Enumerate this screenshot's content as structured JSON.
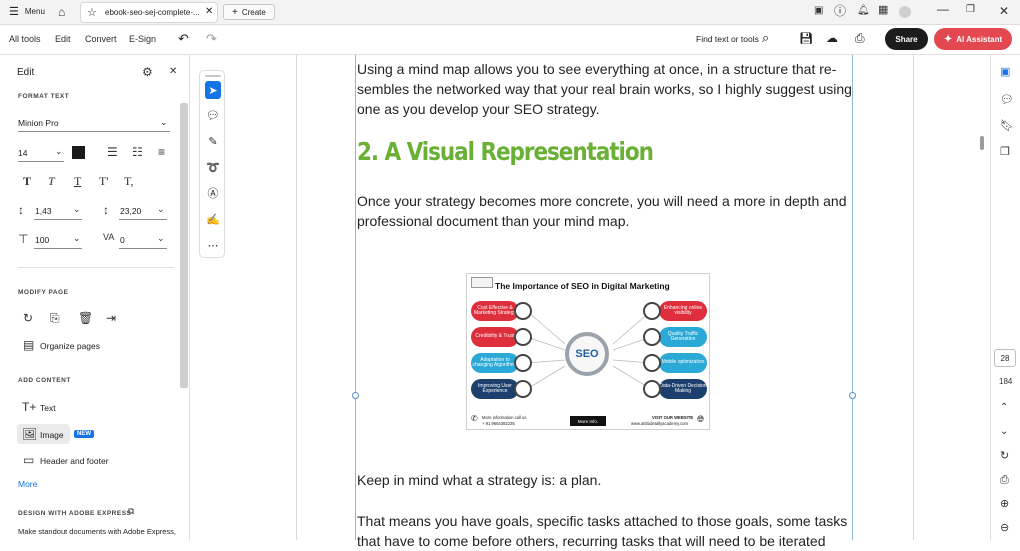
{
  "titlebar": {
    "menu_label": "Menu",
    "doc_tab": "ebook-seo-sej-complete-...",
    "create_label": "Create"
  },
  "toolbar": {
    "tabs": [
      "All tools",
      "Edit",
      "Convert",
      "E-Sign"
    ],
    "find_label": "Find text or tools",
    "share_label": "Share",
    "ai_label": "AI Assistant"
  },
  "left_panel": {
    "title": "Edit",
    "format_text_heading": "FORMAT TEXT",
    "font_name": "Minion Pro",
    "font_size": "14",
    "line_spacing": "1,43",
    "para_spacing": "23,20",
    "scale": "100",
    "char_spacing": "0",
    "modify_page_heading": "MODIFY PAGE",
    "organize_pages": "Organize pages",
    "add_content_heading": "ADD CONTENT",
    "text_item": "Text",
    "image_item": "Image",
    "new_badge": "NEW",
    "header_footer_item": "Header and footer",
    "more_link": "More",
    "design_heading": "DESIGN WITH ADOBE EXPRESS",
    "design_text": "Make standout documents with Adobe Express,"
  },
  "document": {
    "para1": "Using a mind map allows you to see everything at once, in a structure that re-sembles the networked way that your real brain works, so I highly suggest using one as you develop your SEO strategy.",
    "heading": "2. A Visual Representation",
    "para2": "Once your strategy becomes more concrete, you will need a more in depth and professional document than your mind map.",
    "para3": "Keep in mind what a strategy is: a plan.",
    "para4": "That means you have goals, specific tasks attached to those goals, some tasks that have to come before others, recurring tasks that will need to be iterated"
  },
  "infographic": {
    "title": "The  Importance of SEO in Digital Marketing",
    "center": "SEO",
    "left_items": [
      "Cost Effective & Marketing Strategy",
      "Credibility & Trust",
      "Adaptation to changing Algorithms",
      "Improving User Experience"
    ],
    "right_items": [
      "Enhancing online visibility",
      "Quality Traffic Generation",
      "Mobile optimization",
      "Data-Driven Decision Making"
    ],
    "footer_left": "More information call us",
    "footer_phone": "+ 91 9654382235",
    "footer_button": "More Info.",
    "footer_right": "VISIT OUR WEBSITE",
    "footer_url": "www.attitudetallyacademy.com",
    "colors": {
      "red": "#e02f3c",
      "cyan": "#2aa9d6",
      "navy": "#1c3f6e"
    }
  },
  "right_rail": {
    "current_page": "28",
    "total_pages": "184"
  },
  "colors": {
    "heading_green": "#6ab035",
    "ai_red": "#e34850",
    "accent_blue": "#1473e6"
  }
}
